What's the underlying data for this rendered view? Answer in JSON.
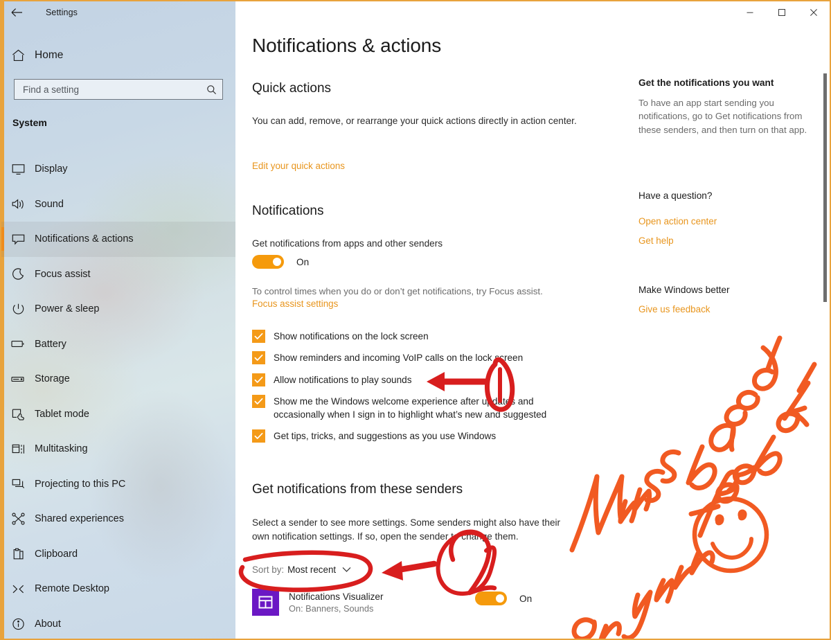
{
  "window": {
    "app_title": "Settings",
    "back_icon": "back-arrow-icon",
    "minimize_label": "–",
    "maximize_label": "☐",
    "close_label": "✕",
    "accent_color": "#e8951d",
    "border_color": "#e8a33d"
  },
  "sidebar": {
    "home_label": "Home",
    "search": {
      "placeholder": "Find a setting",
      "value": "",
      "icon": "search-icon"
    },
    "group_label": "System",
    "items": [
      {
        "label": "Display",
        "icon": "monitor-icon",
        "selected": false
      },
      {
        "label": "Sound",
        "icon": "speaker-icon",
        "selected": false
      },
      {
        "label": "Notifications & actions",
        "icon": "chat-bubble-icon",
        "selected": true
      },
      {
        "label": "Focus assist",
        "icon": "moon-icon",
        "selected": false
      },
      {
        "label": "Power & sleep",
        "icon": "power-icon",
        "selected": false
      },
      {
        "label": "Battery",
        "icon": "battery-icon",
        "selected": false
      },
      {
        "label": "Storage",
        "icon": "drive-icon",
        "selected": false
      },
      {
        "label": "Tablet mode",
        "icon": "tablet-hand-icon",
        "selected": false
      },
      {
        "label": "Multitasking",
        "icon": "multitasking-icon",
        "selected": false
      },
      {
        "label": "Projecting to this PC",
        "icon": "project-screen-icon",
        "selected": false
      },
      {
        "label": "Shared experiences",
        "icon": "share-nodes-icon",
        "selected": false
      },
      {
        "label": "Clipboard",
        "icon": "clipboard-icon",
        "selected": false
      },
      {
        "label": "Remote Desktop",
        "icon": "remote-desktop-icon",
        "selected": false
      },
      {
        "label": "About",
        "icon": "info-circle-icon",
        "selected": false
      }
    ]
  },
  "main": {
    "page_title": "Notifications & actions",
    "quick_actions": {
      "heading": "Quick actions",
      "description": "You can add, remove, or rearrange your quick actions directly in action center.",
      "link": "Edit your quick actions"
    },
    "notifications": {
      "heading": "Notifications",
      "master_label": "Get notifications from apps and other senders",
      "master_state": "On",
      "hint": "To control times when you do or don’t get notifications, try Focus assist.",
      "hint_link": "Focus assist settings",
      "checkboxes": [
        {
          "label": "Show notifications on the lock screen",
          "checked": true
        },
        {
          "label": "Show reminders and incoming VoIP calls on the lock screen",
          "checked": true
        },
        {
          "label": "Allow notifications to play sounds",
          "checked": true
        },
        {
          "label": "Show me the Windows welcome experience after updates and occasionally when I sign in to highlight what’s new and suggested",
          "checked": true
        },
        {
          "label": "Get tips, tricks, and suggestions as you use Windows",
          "checked": true
        }
      ]
    },
    "senders": {
      "heading": "Get notifications from these senders",
      "description": "Select a sender to see more settings. Some senders might also have their own notification settings. If so, open the sender to change them.",
      "sort_key": "Sort by:",
      "sort_value": "Most recent",
      "sort_icon": "chevron-down-icon",
      "list": [
        {
          "name": "Notifications Visualizer",
          "status": "On: Banners, Sounds",
          "toggle_state": "On",
          "icon": "app-tile-icon",
          "icon_color": "#6b18c4"
        }
      ]
    }
  },
  "help_panel": {
    "section1_heading": "Get the notifications you want",
    "section1_text": "To have an app start sending you notifications, go to Get notifications from these senders, and then turn on that app.",
    "section2_heading": "Have a question?",
    "section2_link1": "Open action center",
    "section2_link2": "Get help",
    "section3_heading": "Make Windows better",
    "section3_link1": "Give us feedback"
  },
  "annotations": {
    "ink_color_orange": "#f15a22",
    "ink_color_red": "#d81e1e",
    "handwriting_line1": "Newness based",
    "handwriting_line2": "on your feedback",
    "smiley": "smiley-face-drawing",
    "marker_1": "1",
    "marker_2": "2",
    "callout_1_target": "Allow notifications to play sounds",
    "callout_2_target": "Sort by: Most recent"
  }
}
